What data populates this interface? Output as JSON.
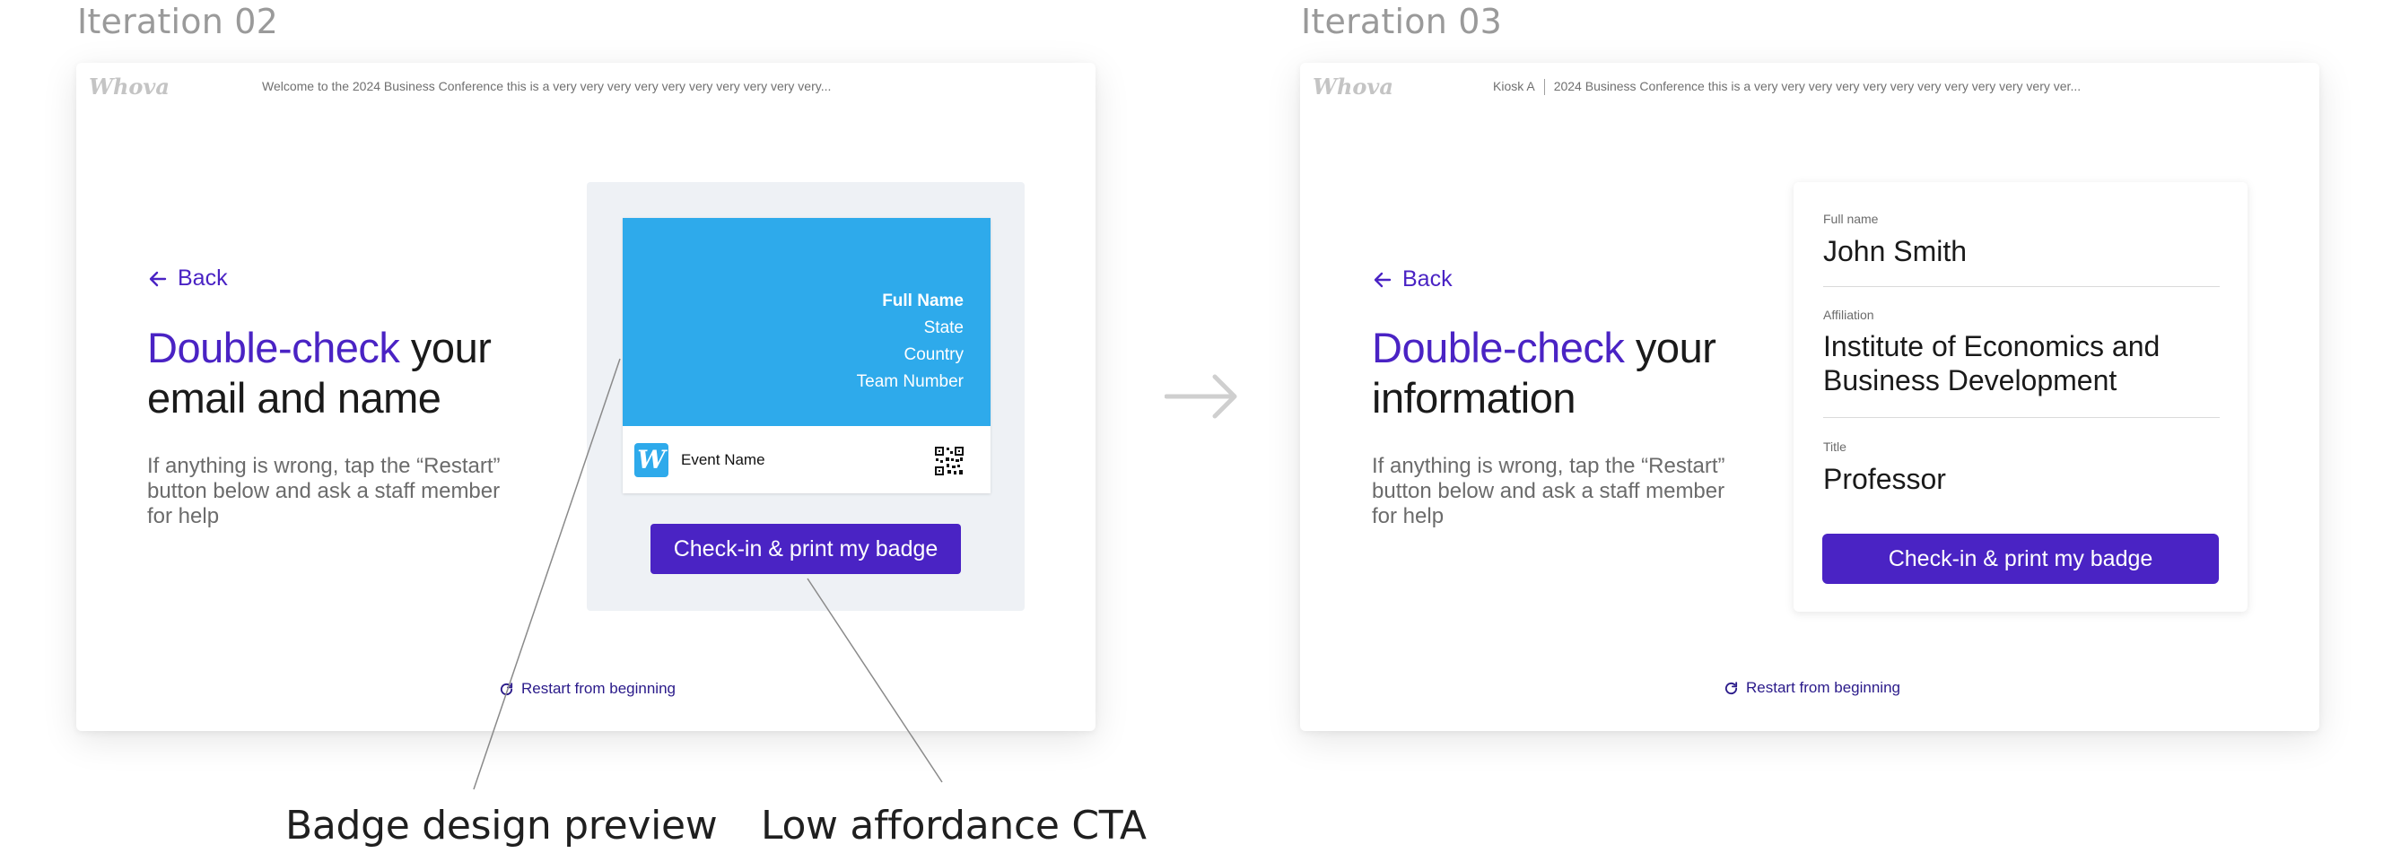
{
  "left": {
    "iteration_label": "Iteration 02",
    "logo": "Whova",
    "topbar_text": "Welcome to the 2024 Business Conference this is a very very very very very very very very very very...",
    "back_label": "Back",
    "headline_accent": "Double-check",
    "headline_rest_1": " your",
    "headline_rest_2": "email and name",
    "helper_lines": [
      "If anything is wrong, tap the “Restart”",
      "button below and ask a staff member",
      "for help"
    ],
    "badge": {
      "lines": [
        "Full Name",
        "State",
        "Country",
        "Team Number"
      ],
      "logo_letter": "W",
      "event_name": "Event Name"
    },
    "cta_label": "Check-in & print my badge",
    "restart_label": "Restart from beginning"
  },
  "right": {
    "iteration_label": "Iteration 03",
    "logo": "Whova",
    "kiosk": "Kiosk A",
    "topbar_text": "2024 Business Conference this is a very very very very very very very very very very very ver...",
    "back_label": "Back",
    "headline_accent": "Double-check",
    "headline_rest_1": " your",
    "headline_rest_2": "information",
    "helper_lines": [
      "If anything is wrong, tap the “Restart”",
      "button below and ask a staff member",
      "for help"
    ],
    "fields": [
      {
        "label": "Full name",
        "value_lines": [
          "John Smith"
        ]
      },
      {
        "label": "Affiliation",
        "value_lines": [
          "Institute of Economics and",
          "Business Development"
        ]
      },
      {
        "label": "Title",
        "value_lines": [
          "Professor"
        ]
      }
    ],
    "cta_label": "Check-in & print my badge",
    "restart_label": "Restart from beginning"
  },
  "annotations": {
    "badge_preview": "Badge design preview",
    "low_affordance": "Low affordance CTA"
  },
  "colors": {
    "accent": "#4a23c4",
    "badge_blue": "#2eaaeb",
    "panel_gray": "#eef1f5"
  }
}
